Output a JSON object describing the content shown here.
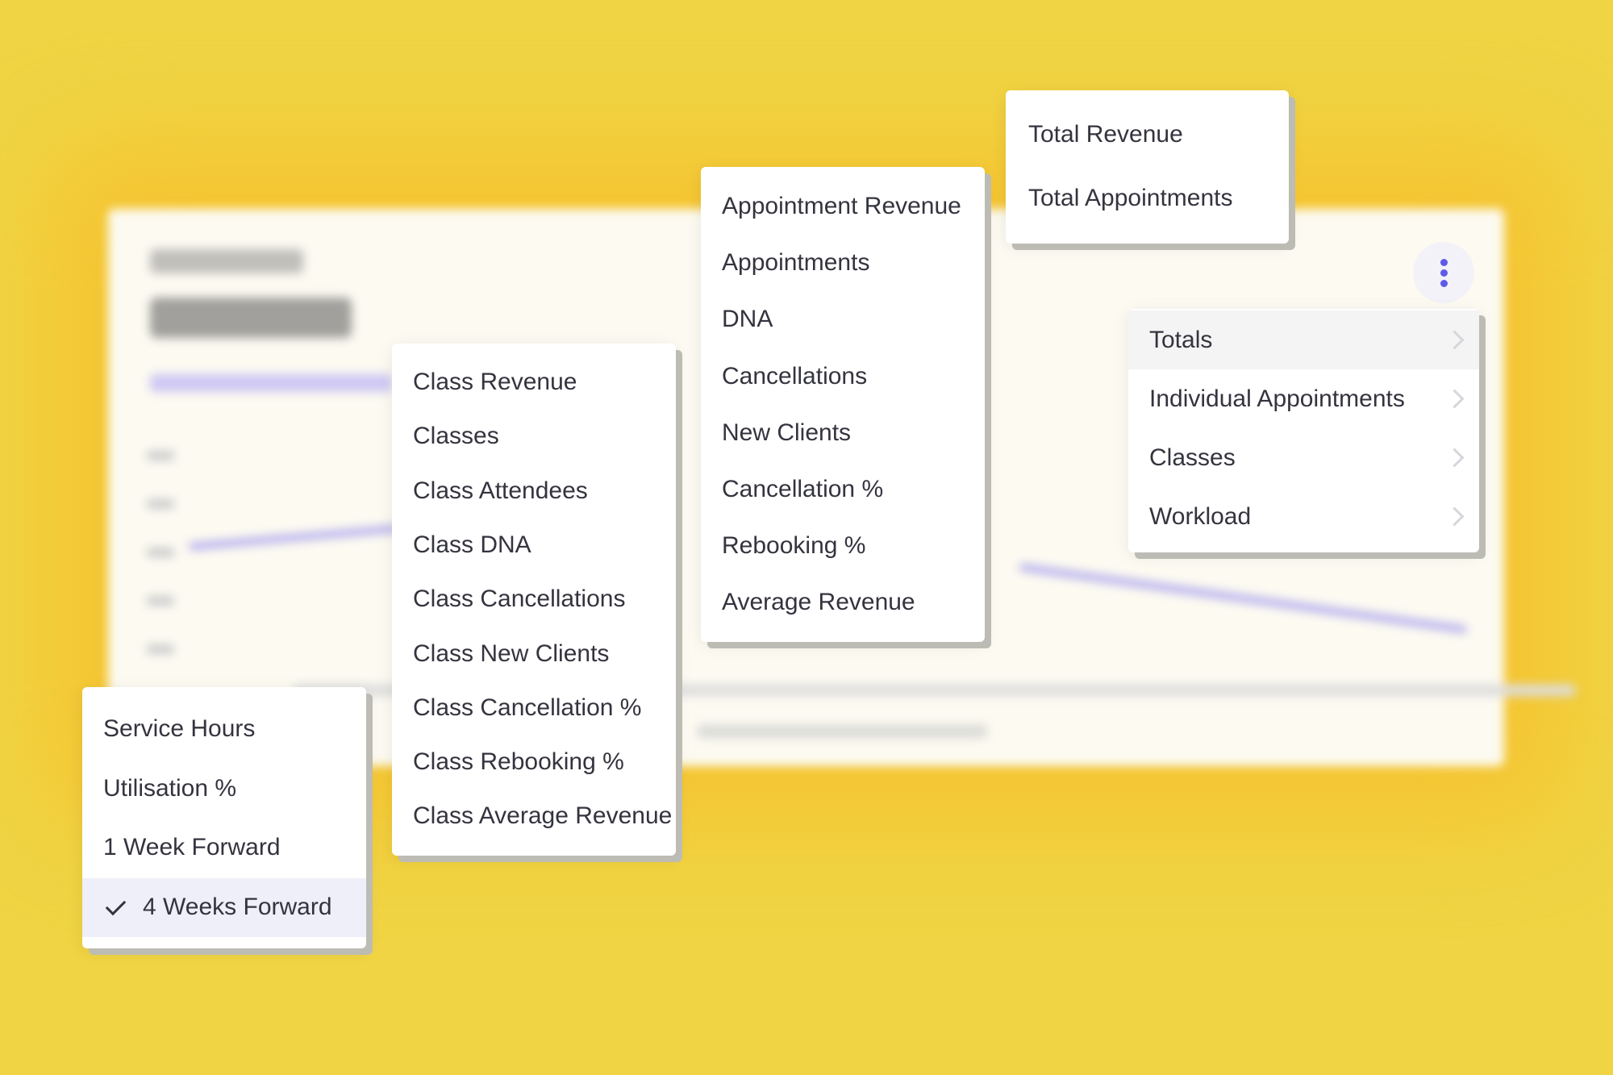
{
  "colors": {
    "background": "#F0D443",
    "accent": "#5F5AE8",
    "selected_bg": "#EEEFF8",
    "hover_bg": "#F4F4F4"
  },
  "kebab_menu": {
    "icon": "more-vertical-icon"
  },
  "main_menu": {
    "items": [
      {
        "label": "Totals",
        "has_submenu": true,
        "highlighted": true
      },
      {
        "label": "Individual Appointments",
        "has_submenu": true
      },
      {
        "label": "Classes",
        "has_submenu": true
      },
      {
        "label": "Workload",
        "has_submenu": true
      }
    ]
  },
  "totals_menu": {
    "items": [
      {
        "label": "Total Revenue"
      },
      {
        "label": "Total Appointments"
      }
    ]
  },
  "appointments_menu": {
    "items": [
      {
        "label": "Appointment Revenue"
      },
      {
        "label": "Appointments"
      },
      {
        "label": "DNA"
      },
      {
        "label": "Cancellations"
      },
      {
        "label": "New Clients"
      },
      {
        "label": "Cancellation %"
      },
      {
        "label": "Rebooking %"
      },
      {
        "label": "Average Revenue"
      }
    ]
  },
  "classes_menu": {
    "items": [
      {
        "label": "Class Revenue"
      },
      {
        "label": "Classes"
      },
      {
        "label": "Class Attendees"
      },
      {
        "label": "Class DNA"
      },
      {
        "label": "Class Cancellations"
      },
      {
        "label": "Class New Clients"
      },
      {
        "label": "Class Cancellation %"
      },
      {
        "label": "Class Rebooking %"
      },
      {
        "label": "Class Average Revenue"
      }
    ]
  },
  "workload_menu": {
    "items": [
      {
        "label": "Service Hours"
      },
      {
        "label": "Utilisation %"
      },
      {
        "label": "1 Week Forward"
      },
      {
        "label": "4 Weeks Forward",
        "selected": true
      }
    ]
  }
}
